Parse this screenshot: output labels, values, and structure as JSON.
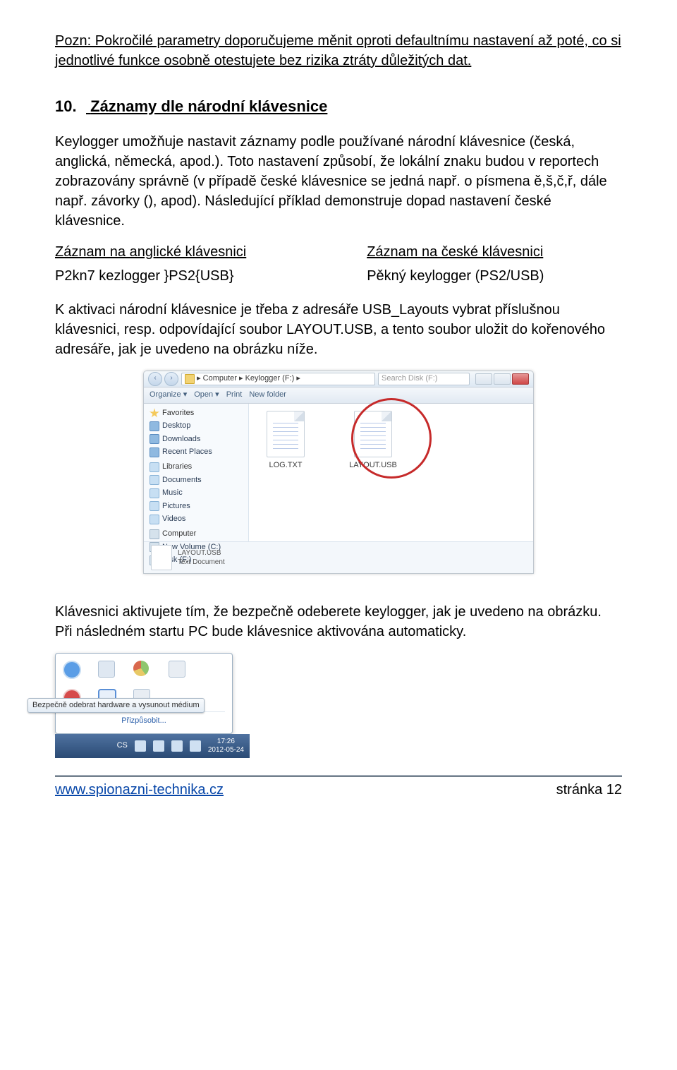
{
  "note": "Pozn: Pokročilé parametry doporučujeme měnit oproti defaultnímu nastavení až poté, co si jednotlivé funkce osobně otestujete bez rizika ztráty důležitých dat.",
  "heading_number": "10.",
  "heading_text": "Záznamy dle národní klávesnice",
  "para1": "Keylogger umožňuje nastavit záznamy podle používané národní klávesnice (česká, anglická, německá, apod.). Toto nastavení způsobí, že lokální znaku budou v reportech zobrazovány správně (v případě české klávesnice se jedná např. o písmena ě,š,č,ř, dále např. závorky (), apod). Následující příklad demonstruje dopad nastavení české klávesnice.",
  "row1_left": "Záznam na anglické klávesnici",
  "row1_right": "Záznam na české klávesnici",
  "row2_left": "P2kn7 kezlogger }PS2{USB}",
  "row2_right": "Pěkný keylogger (PS2/USB)",
  "para2": "K aktivaci národní klávesnice je třeba z adresáře USB_Layouts vybrat příslušnou klávesnici, resp. odpovídající soubor LAYOUT.USB, a tento soubor uložit do kořenového adresáře, jak je uvedeno na obrázku níže.",
  "explorer": {
    "breadcrumb": "▸ Computer ▸ Keylogger (F:) ▸",
    "search_placeholder": "Search Disk (F:)",
    "toolbar": {
      "organize": "Organize ▾",
      "open": "Open ▾",
      "print": "Print",
      "newfolder": "New folder"
    },
    "sidebar": {
      "favorites": "Favorites",
      "items_fav": [
        "Desktop",
        "Downloads",
        "Recent Places"
      ],
      "libraries": "Libraries",
      "items_lib": [
        "Documents",
        "Music",
        "Pictures",
        "Videos"
      ],
      "computer": "Computer",
      "items_comp": [
        "New Volume (C:)",
        "Disk (F:)"
      ]
    },
    "files": {
      "f1": "LOG.TXT",
      "f2": "LAYOUT.USB"
    },
    "status_name": "LAYOUT.USB",
    "status_type": "Text Document"
  },
  "para3": "Klávesnici aktivujete tím, že bezpečně odeberete keylogger, jak je uvedeno na obrázku. Při následném startu PC bude klávesnice aktivována automaticky.",
  "tray": {
    "tooltip": "Bezpečně odebrat hardware a vysunout médium",
    "customize": "Přizpůsobit...",
    "lang": "CS",
    "time": "17:26",
    "date": "2012-05-24"
  },
  "footer": {
    "url": "www.spionazni-technika.cz",
    "page": "stránka 12"
  }
}
